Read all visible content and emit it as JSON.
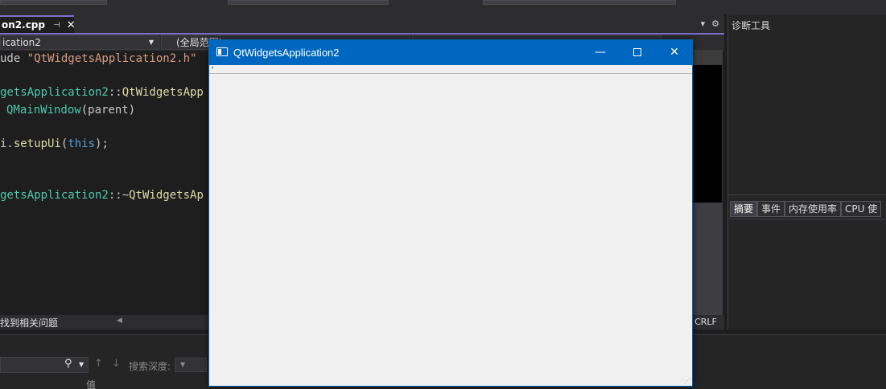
{
  "tab": {
    "label": "on2.cpp",
    "pin_icon": "pin-icon",
    "close_icon": "close-icon"
  },
  "tabbar": {
    "dropdown_icon": "chevron-down-icon",
    "settings_icon": "gear-icon"
  },
  "nav": {
    "project": "ication2",
    "scope": "(全局范围)"
  },
  "code": {
    "line1_prefix": "ude ",
    "line1_string": "\"QtWidgetsApplication2.h\"",
    "line3_type": "getsApplication2",
    "line3_sep": "::",
    "line3_fn": "QtWidgetsApp",
    "line4_type": "QMainWindow",
    "line4_args": "(parent)",
    "line6_prefix": "i.",
    "line6_fn": "setupUi",
    "line6_open": "(",
    "line6_this": "this",
    "line6_close": ");",
    "line9_type": "getsApplication2",
    "line9_sep": "::~",
    "line9_fn": "QtWidgetsAp"
  },
  "editor_status": {
    "issues": "找到相关问题",
    "line_ending": "CRLF"
  },
  "bottom": {
    "search_depth_label": "搜索深度:",
    "value_header": "值"
  },
  "diagnostics": {
    "title": "诊断工具",
    "tabs": [
      "摘要",
      "事件",
      "内存使用率",
      "CPU 使"
    ]
  },
  "qt_window": {
    "title": "QtWidgetsApplication2",
    "minimize_glyph": "—",
    "close_glyph": "✕",
    "grip_glyph": "⋰"
  }
}
